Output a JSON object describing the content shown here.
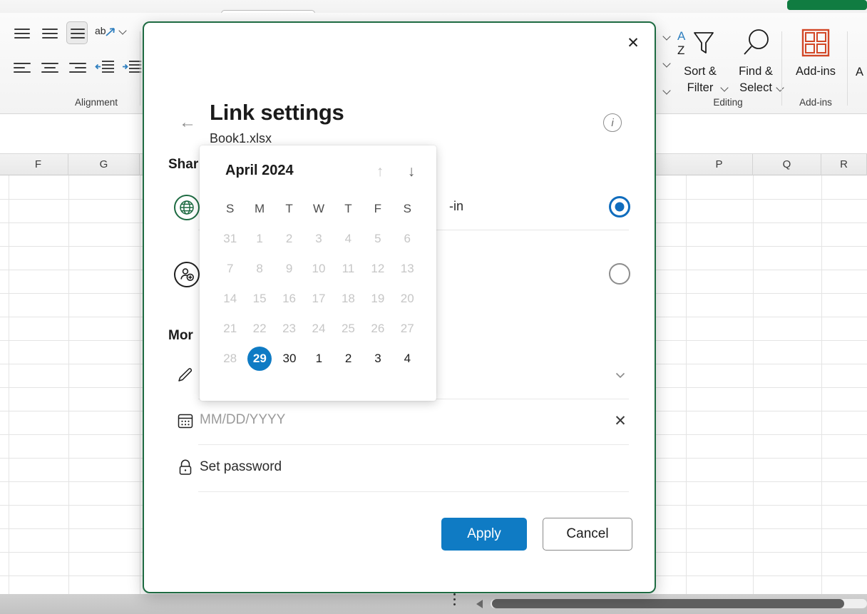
{
  "excel": {
    "ribbon_groups": [
      {
        "label": "Alignment"
      },
      {
        "label": "Editing"
      },
      {
        "label": "Add-ins"
      }
    ],
    "buttons": {
      "sort_filter": "Sort &\nFilter",
      "sort_filter_l1": "Sort &",
      "sort_filter_l2": "Filter",
      "find_select_l1": "Find &",
      "find_select_l2": "Select",
      "add_ins": "Add-ins",
      "add_ins_partial": "A"
    },
    "columns": [
      "F",
      "G",
      "P",
      "Q",
      "R"
    ],
    "column_left": [
      "F",
      "G"
    ],
    "column_right": [
      "P",
      "Q",
      "R"
    ]
  },
  "dialog": {
    "title": "Link settings",
    "subtitle": "Book1.xlsx",
    "close_label": "✕",
    "back_label": "←",
    "info_label": "i",
    "share_section_heading": "Shar",
    "more_section_heading": "Mor",
    "share_options": [
      {
        "icon": "globe-icon",
        "label": "-in",
        "selected": true
      },
      {
        "icon": "person-add-icon",
        "label": "",
        "selected": false
      }
    ],
    "fields": [
      {
        "icon": "pencil-icon",
        "value": "",
        "trailing": "chevron-down-icon",
        "trailing_glyph": "⌄"
      },
      {
        "icon": "calendar-icon",
        "value": "MM/DD/YYYY",
        "is_placeholder": true,
        "trailing": "clear-icon",
        "trailing_glyph": "✕"
      },
      {
        "icon": "lock-icon",
        "value": "Set password",
        "is_placeholder": false,
        "trailing": "",
        "trailing_glyph": ""
      }
    ],
    "apply_label": "Apply",
    "cancel_label": "Cancel",
    "accent_color": "#0f7bc4",
    "border_color": "#1e6b42"
  },
  "calendar": {
    "month_label": "April 2024",
    "prev_label": "↑",
    "next_label": "↓",
    "day_headers": [
      "S",
      "M",
      "T",
      "W",
      "T",
      "F",
      "S"
    ],
    "selected_day": "29",
    "weeks": [
      [
        {
          "d": "31",
          "dim": true
        },
        {
          "d": "1",
          "dim": true
        },
        {
          "d": "2",
          "dim": true
        },
        {
          "d": "3",
          "dim": true
        },
        {
          "d": "4",
          "dim": true
        },
        {
          "d": "5",
          "dim": true
        },
        {
          "d": "6",
          "dim": true
        }
      ],
      [
        {
          "d": "7",
          "dim": true
        },
        {
          "d": "8",
          "dim": true
        },
        {
          "d": "9",
          "dim": true
        },
        {
          "d": "10",
          "dim": true
        },
        {
          "d": "11",
          "dim": true
        },
        {
          "d": "12",
          "dim": true
        },
        {
          "d": "13",
          "dim": true
        }
      ],
      [
        {
          "d": "14",
          "dim": true
        },
        {
          "d": "15",
          "dim": true
        },
        {
          "d": "16",
          "dim": true
        },
        {
          "d": "17",
          "dim": true
        },
        {
          "d": "18",
          "dim": true
        },
        {
          "d": "19",
          "dim": true
        },
        {
          "d": "20",
          "dim": true
        }
      ],
      [
        {
          "d": "21",
          "dim": true
        },
        {
          "d": "22",
          "dim": true
        },
        {
          "d": "23",
          "dim": true
        },
        {
          "d": "24",
          "dim": true
        },
        {
          "d": "25",
          "dim": true
        },
        {
          "d": "26",
          "dim": true
        },
        {
          "d": "27",
          "dim": true
        }
      ],
      [
        {
          "d": "28",
          "dim": true
        },
        {
          "d": "29",
          "dim": false,
          "selected": true
        },
        {
          "d": "30",
          "dim": false
        },
        {
          "d": "1",
          "dim": false
        },
        {
          "d": "2",
          "dim": false
        },
        {
          "d": "3",
          "dim": false
        },
        {
          "d": "4",
          "dim": false
        }
      ]
    ]
  }
}
